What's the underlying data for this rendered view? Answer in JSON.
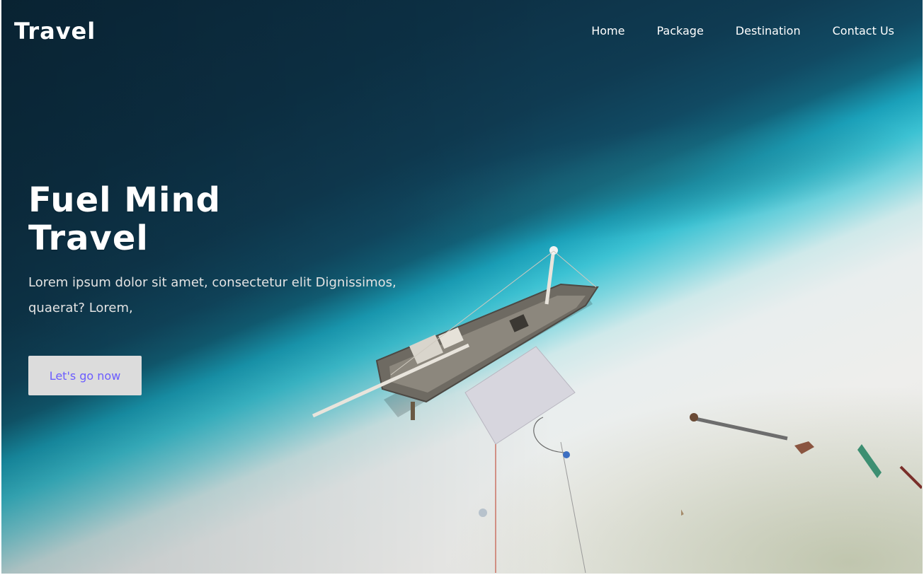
{
  "header": {
    "brand": "Travel",
    "nav": [
      "Home",
      "Package",
      "Destination",
      "Contact Us"
    ]
  },
  "hero": {
    "headline_line1": "Fuel Mind",
    "headline_line2": "Travel",
    "subtitle": "Lorem ipsum dolor sit amet, consectetur elit Dignissimos, quaerat? Lorem,",
    "cta_label": "Let's go now",
    "background_image": "aerial-beach-with-sailboat"
  },
  "colors": {
    "cta_text": "#6b5cff",
    "cta_background": "#dcdcdc",
    "nav_text": "#ffffff"
  }
}
